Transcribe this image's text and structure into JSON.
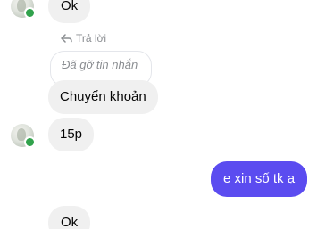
{
  "messages": {
    "top_ok": "Ok",
    "reply_label": "Trả lời",
    "removed_text": "Đã gỡ tin nhắn",
    "transfer": "Chuyển khoản",
    "minutes": "15p",
    "sent": "e xin số tk ạ",
    "bottom_ok": "Ok"
  },
  "colors": {
    "sent_bubble": "#5b4cf0",
    "received_bubble": "#f0f0f0",
    "online": "#31a24c"
  },
  "icons": {
    "reply": "reply-arrow-icon"
  }
}
